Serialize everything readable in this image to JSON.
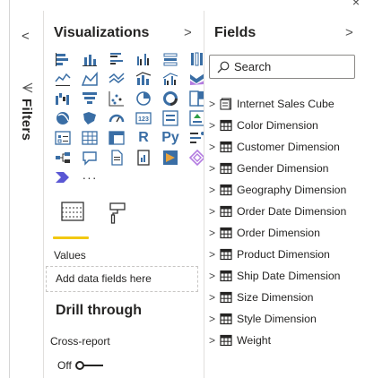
{
  "window": {
    "close_glyph": "×"
  },
  "filters": {
    "collapse_glyph": "<",
    "label": "Filters"
  },
  "visualizations": {
    "title": "Visualizations",
    "expand_glyph": ">",
    "icons": [
      "stacked-bar-chart",
      "stacked-column-chart",
      "clustered-bar-chart",
      "clustered-column-chart",
      "100-stacked-bar-chart",
      "100-stacked-column-chart",
      "line-chart",
      "area-chart",
      "stacked-area-chart",
      "line-and-stacked-column-chart",
      "line-and-clustered-column-chart",
      "ribbon-chart",
      "waterfall-chart",
      "funnel-chart",
      "scatter-chart",
      "pie-chart",
      "donut-chart",
      "treemap",
      "map",
      "filled-map",
      "gauge",
      "card",
      "multi-row-card",
      "kpi",
      "slicer",
      "table",
      "matrix",
      "r-script-visual",
      "python-visual",
      "key-influencers",
      "decomposition-tree",
      "qa-visual",
      "smart-narrative",
      "paginated-report",
      "power-apps",
      "power-automate",
      "more-visuals"
    ],
    "r_label": "R",
    "py_label": "Py",
    "more_glyph": "···",
    "values_label": "Values",
    "add_fields_placeholder": "Add data fields here",
    "drill_through_title": "Drill through",
    "cross_report_label": "Cross-report",
    "toggle_state": "Off"
  },
  "fields": {
    "title": "Fields",
    "expand_glyph": ">",
    "search_placeholder": "Search",
    "items": [
      {
        "label": "Internet Sales Cube",
        "icon": "cube-icon"
      },
      {
        "label": "Color Dimension",
        "icon": "table-icon"
      },
      {
        "label": "Customer Dimension",
        "icon": "table-icon"
      },
      {
        "label": "Gender Dimension",
        "icon": "table-icon"
      },
      {
        "label": "Geography Dimension",
        "icon": "table-icon"
      },
      {
        "label": "Order Date Dimension",
        "icon": "table-icon"
      },
      {
        "label": "Order Dimension",
        "icon": "table-icon"
      },
      {
        "label": "Product Dimension",
        "icon": "table-icon"
      },
      {
        "label": "Ship Date Dimension",
        "icon": "table-icon"
      },
      {
        "label": "Size Dimension",
        "icon": "table-icon"
      },
      {
        "label": "Style Dimension",
        "icon": "table-icon"
      },
      {
        "label": "Weight",
        "icon": "table-icon"
      }
    ]
  },
  "colors": {
    "accent": "#f2c811",
    "icon_blue": "#3a6ea5",
    "text": "#252423"
  }
}
